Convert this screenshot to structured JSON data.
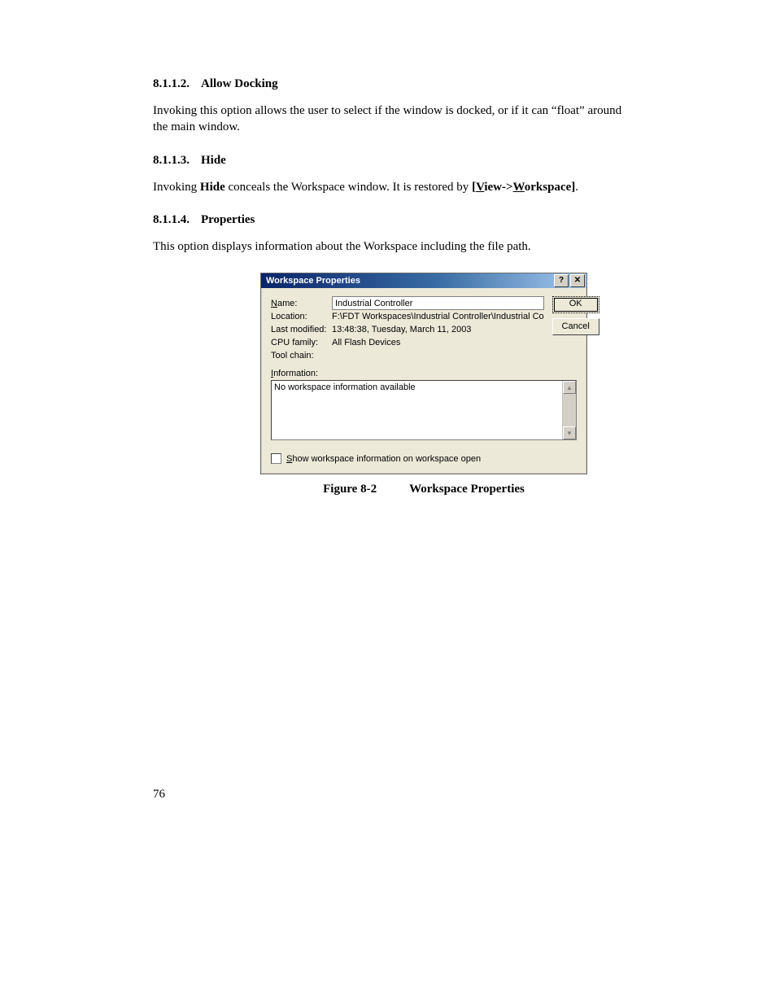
{
  "sections": {
    "s1": {
      "num": "8.1.1.2.",
      "title": "Allow Docking",
      "body": "Invoking this option allows the user to select if the window is docked, or if it can “float” around the main window."
    },
    "s2": {
      "num": "8.1.1.3.",
      "title": "Hide",
      "body_pre": "Invoking ",
      "body_bold": "Hide",
      "body_mid": " conceals the Workspace window. It is restored by ",
      "menu_open": "[",
      "menu_view_u": "V",
      "menu_view_rest": "iew->",
      "menu_ws_u": "W",
      "menu_ws_rest": "orkspace",
      "menu_close": "]",
      "body_end": "."
    },
    "s3": {
      "num": "8.1.1.4.",
      "title": "Properties",
      "body": "This option displays information about the Workspace including the file path."
    }
  },
  "dialog": {
    "title": "Workspace Properties",
    "help_glyph": "?",
    "close_glyph": "✕",
    "fields": {
      "name_label_u": "N",
      "name_label_rest": "ame:",
      "name_value": "Industrial Controller",
      "location_label": "Location:",
      "location_value": "F:\\FDT Workspaces\\Industrial Controller\\Industrial Co",
      "modified_label": "Last modified:",
      "modified_value": "13:48:38, Tuesday, March 11, 2003",
      "cpu_label": "CPU family:",
      "cpu_value": "All Flash Devices",
      "toolchain_label": "Tool chain:",
      "toolchain_value": ""
    },
    "info_label_u": "I",
    "info_label_rest": "nformation:",
    "info_text": "No workspace information available",
    "checkbox_u": "S",
    "checkbox_rest": "how workspace information on workspace open",
    "buttons": {
      "ok": "OK",
      "cancel": "Cancel"
    },
    "scroll_up": "▲",
    "scroll_down": "▼"
  },
  "figure": {
    "number": "Figure 8-2",
    "caption": "Workspace Properties"
  },
  "page_number": "76"
}
